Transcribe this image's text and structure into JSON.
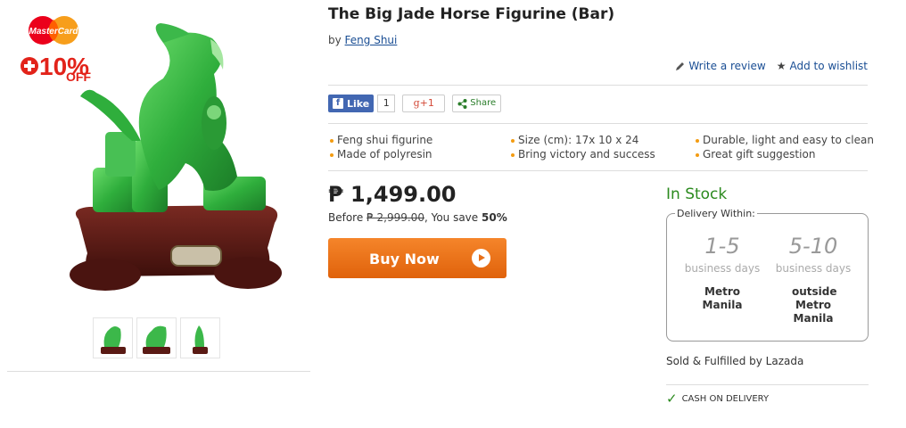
{
  "promo": {
    "card_label": "MasterCard",
    "discount": "+10%",
    "off_label": "OFF",
    "colors": {
      "mc_red": "#eb001b",
      "mc_yellow": "#f79e1b",
      "off_red": "#e2231a"
    }
  },
  "gallery": {
    "thumbnails": [
      "thumb-front",
      "thumb-side",
      "thumb-back"
    ]
  },
  "product": {
    "title": "The Big Jade Horse Figurine (Bar)",
    "by_label": "by",
    "brand": "Feng Shui",
    "write_review": "Write a review",
    "add_wishlist": "Add to wishlist"
  },
  "social": {
    "like_label": "Like",
    "like_count": "1",
    "gplus_label": "+1",
    "share_label": "Share"
  },
  "features": [
    "Feng shui figurine",
    "Size (cm): 17x 10 x 24",
    "Durable, light and easy to clean",
    "Made of polyresin",
    "Bring victory and success",
    "Great gift suggestion"
  ],
  "pricing": {
    "price": "₱ 1,499.00",
    "before_label": "Before",
    "old_price": "₱ 2,999.00",
    "save_label": ", You save",
    "save_percent": "50%",
    "buy_label": "Buy Now"
  },
  "availability": {
    "stock": "In Stock",
    "delivery_legend": "Delivery Within:",
    "options": [
      {
        "range": "1-5",
        "unit": "business days",
        "location": "Metro Manila"
      },
      {
        "range": "5-10",
        "unit": "business days",
        "location": "outside Metro Manila"
      }
    ],
    "sold_by": "Sold & Fulfilled by Lazada",
    "cod": "CASH ON DELIVERY"
  },
  "colors": {
    "accent_orange": "#ec7020",
    "link_blue": "#1a4e94",
    "stock_green": "#2b8a1e",
    "jade": "#3cb84a",
    "base_brown": "#5a1a14"
  }
}
